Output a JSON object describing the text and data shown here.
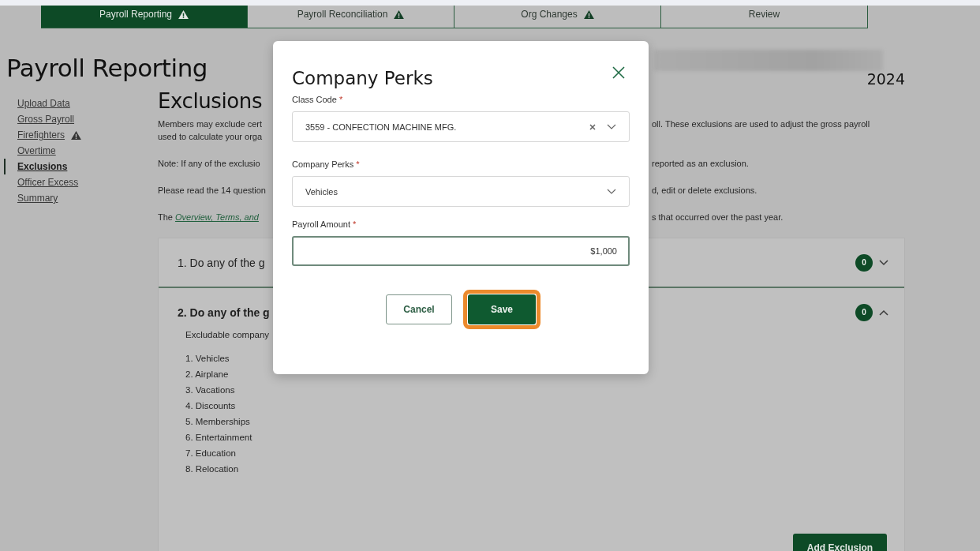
{
  "tabs": [
    {
      "label": "Payroll Reporting",
      "warning": true,
      "selected": true
    },
    {
      "label": "Payroll Reconciliation",
      "warning": true,
      "selected": false
    },
    {
      "label": "Org Changes",
      "warning": true,
      "selected": false
    },
    {
      "label": "Review",
      "warning": false,
      "selected": false
    }
  ],
  "page_title": "Payroll Reporting",
  "year": "2024",
  "sidebar": {
    "items": [
      {
        "label": "Upload Data",
        "selected": false,
        "warning": false
      },
      {
        "label": "Gross Payroll",
        "selected": false,
        "warning": false
      },
      {
        "label": "Firefighters",
        "selected": false,
        "warning": true
      },
      {
        "label": "Overtime",
        "selected": false,
        "warning": false
      },
      {
        "label": "Exclusions",
        "selected": true,
        "warning": false
      },
      {
        "label": "Officer Excess",
        "selected": false,
        "warning": false
      },
      {
        "label": "Summary",
        "selected": false,
        "warning": false
      }
    ]
  },
  "section_title": "Exclusions",
  "paragraphs": [
    {
      "lines": [
        {
          "left": "Members may exclude cert",
          "right": "oll. These exclusions are used to adjust the gross payroll"
        },
        {
          "left": "used to calculate your orga"
        }
      ]
    },
    {
      "lines": [
        {
          "left": "Note: If any of the exclusio",
          "right": "reported as an exclusion."
        }
      ]
    },
    {
      "lines": [
        {
          "left": "Please read the 14 question",
          "right": "d, edit or delete exclusions."
        }
      ]
    },
    {
      "lines": [
        {
          "left": "The",
          "link": "Overview, Terms, and",
          "right": "s that occurred over the past year."
        }
      ]
    }
  ],
  "questions": [
    {
      "title": "1. Do any of the g",
      "count": "0",
      "expanded": false
    },
    {
      "title": "2. Do any of the g",
      "count": "0",
      "expanded": true,
      "intro": "Excludable company",
      "items": [
        "1. Vehicles",
        "2. Airplane",
        "3. Vacations",
        "4. Discounts",
        "5. Memberships",
        "6. Entertainment",
        "7. Education",
        "8. Relocation"
      ]
    }
  ],
  "add_button": "Add Exclusion",
  "modal": {
    "title": "Company Perks",
    "fields": [
      {
        "kind": "select",
        "label": "Class Code",
        "required_mark": "*",
        "value": "3559 - CONFECTION MACHINE MFG.",
        "clearable": true
      },
      {
        "kind": "select",
        "label": "Company Perks",
        "required_mark": "*",
        "value": "Vehicles",
        "clearable": false
      },
      {
        "kind": "text",
        "label": "Payroll Amount",
        "required_mark": "*",
        "value": "$1,000"
      }
    ],
    "buttons": [
      {
        "label": "Cancel",
        "kind": "secondary",
        "highlighted": false
      },
      {
        "label": "Save",
        "kind": "primary",
        "highlighted": true
      }
    ]
  }
}
